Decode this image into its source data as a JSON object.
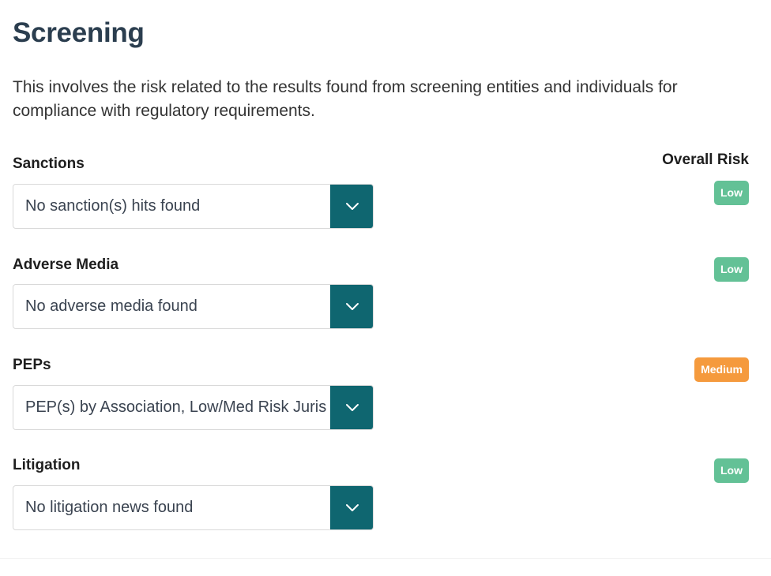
{
  "page": {
    "title": "Screening",
    "description": "This involves the risk related to the results found from screening entities and individuals for compliance with regulatory requirements.",
    "overall_risk_label": "Overall Risk"
  },
  "colors": {
    "title": "#2b3e4f",
    "select_button": "#0f6670",
    "badge_low": "#63c196",
    "badge_medium": "#f59a3d"
  },
  "sections": [
    {
      "label": "Sanctions",
      "value": "No sanction(s) hits found",
      "risk": "Low",
      "icon": "chevron-down-icon"
    },
    {
      "label": "Adverse Media",
      "value": "No adverse media found",
      "risk": "Low",
      "icon": "chevron-down-icon"
    },
    {
      "label": "PEPs",
      "value": "PEP(s) by Association, Low/Med Risk Jurisdiction",
      "risk": "Medium",
      "icon": "chevron-down-icon"
    },
    {
      "label": "Litigation",
      "value": "No litigation news found",
      "risk": "Low",
      "icon": "chevron-down-icon"
    }
  ]
}
